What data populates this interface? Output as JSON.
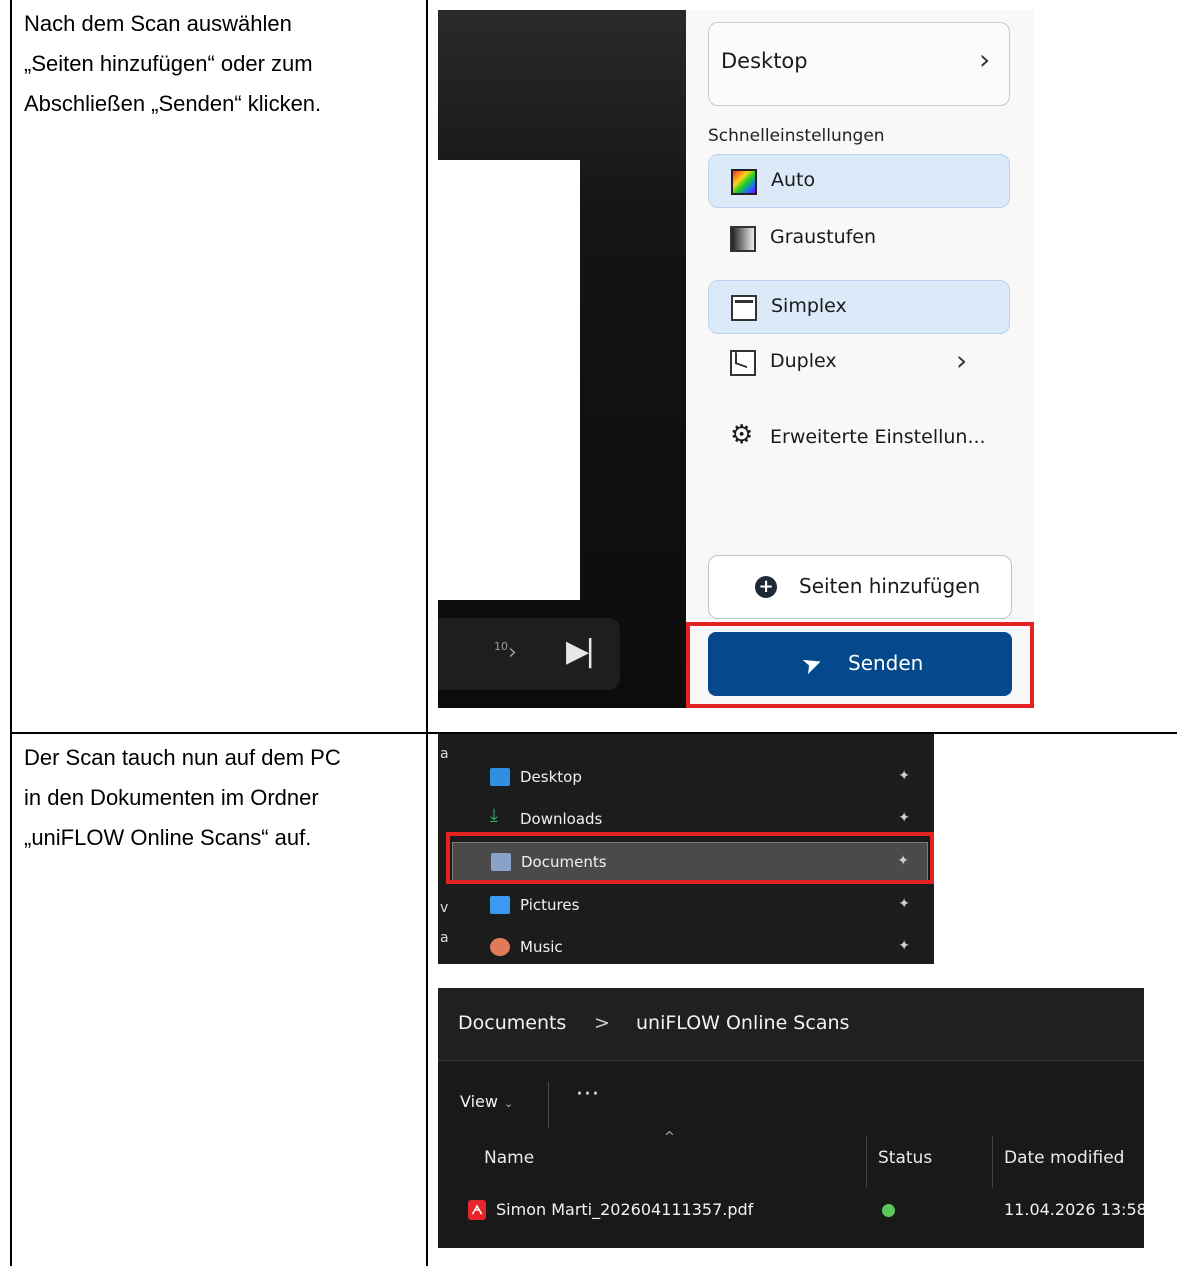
{
  "rows": [
    {
      "instruction_lines": [
        "Nach dem Scan auswählen",
        "„Seiten hinzufügen“ oder zum",
        "Abschließen „Senden“ klicken."
      ]
    },
    {
      "instruction_lines": [
        "Der Scan tauch nun auf dem PC",
        "in den Dokumenten im Ordner",
        "„uniFLOW Online Scans“ auf."
      ]
    }
  ],
  "scan_app": {
    "destination_label": "Desktop",
    "quick_settings_heading": "Schnelleinstellungen",
    "quick_settings": [
      {
        "label": "Auto",
        "icon": "color-mode-icon",
        "selected": true
      },
      {
        "label": "Graustufen",
        "icon": "grayscale-icon",
        "selected": false
      },
      {
        "label": "Simplex",
        "icon": "simplex-page-icon",
        "selected": true
      },
      {
        "label": "Duplex",
        "icon": "duplex-page-icon",
        "selected": false
      }
    ],
    "advanced_label": "Erweiterte Einstellun...",
    "add_pages_label": "Seiten hinzufügen",
    "send_label": "Senden",
    "pager_next_label": "10",
    "highlight_color": "#e52222",
    "send_color": "#03498b"
  },
  "quick_access": {
    "side_letters": [
      "a",
      "v",
      "a"
    ],
    "items": [
      {
        "label": "Desktop",
        "icon": "desktop-folder-icon",
        "color": "#2f8fe0"
      },
      {
        "label": "Downloads",
        "icon": "download-arrow-icon",
        "color": "#2fb36a"
      },
      {
        "label": "Documents",
        "icon": "documents-folder-icon",
        "color": "#8aa2c8"
      },
      {
        "label": "Pictures",
        "icon": "pictures-folder-icon",
        "color": "#3a9af0"
      },
      {
        "label": "Music",
        "icon": "music-folder-icon",
        "color": "#e07a5a"
      }
    ],
    "highlighted": "Documents"
  },
  "explorer": {
    "breadcrumb": [
      "Documents",
      "uniFLOW Online Scans"
    ],
    "breadcrumb_separator": ">",
    "view_label": "View",
    "more_label": "···",
    "columns": [
      "Name",
      "Status",
      "Date modified"
    ],
    "files": [
      {
        "name": "Simon Marti_202604111357.pdf",
        "date_modified": "11.04.2026 13:58",
        "status": "synced"
      }
    ]
  }
}
